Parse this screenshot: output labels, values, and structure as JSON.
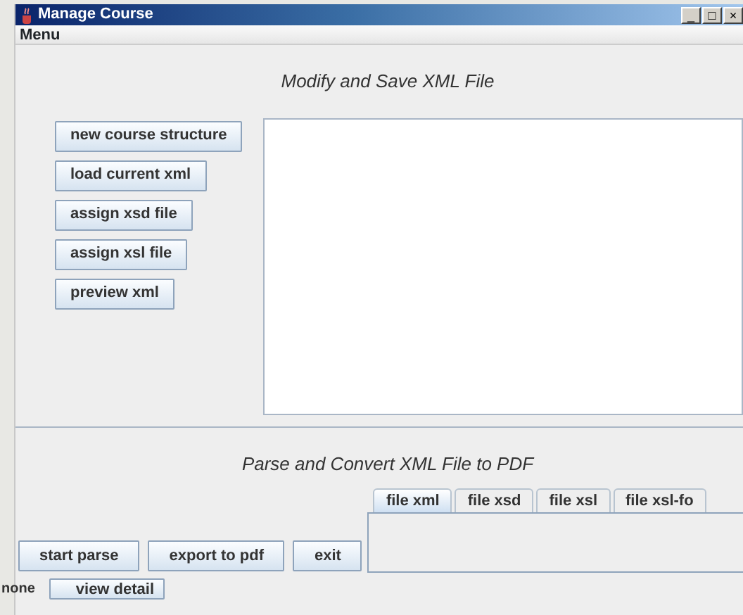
{
  "window": {
    "title": "Manage Course",
    "controls": [
      "_",
      "□",
      "×"
    ]
  },
  "menu": [
    "Menu"
  ],
  "modify_section": {
    "heading": "Modify and Save XML File",
    "buttons": [
      "new course structure",
      "load current xml",
      "assign xsd file",
      "assign xsl file",
      "preview xml"
    ]
  },
  "convert_section": {
    "heading": "Parse and Convert XML File to PDF",
    "tabs": [
      {
        "label": "file xml",
        "selected": true
      },
      {
        "label": "file xsd",
        "selected": false
      },
      {
        "label": "file xsl",
        "selected": false
      },
      {
        "label": "file xsl-fo",
        "selected": false
      }
    ],
    "buttons": [
      "start parse",
      "export to pdf",
      "exit"
    ]
  },
  "status_bar": {
    "text": "none",
    "button": "view detail"
  }
}
